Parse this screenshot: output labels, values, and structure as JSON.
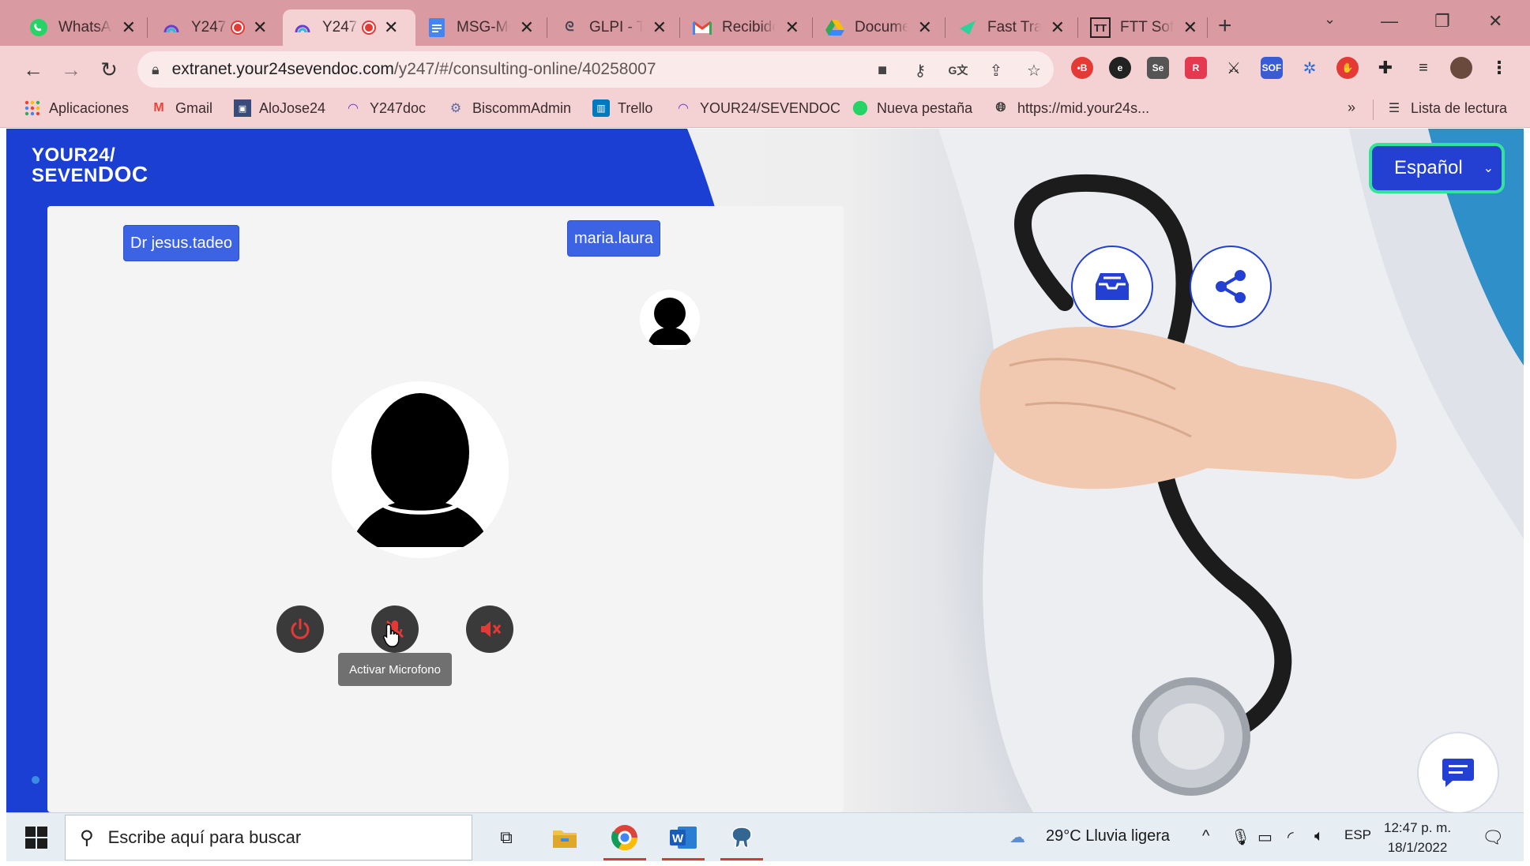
{
  "browser": {
    "tabs": [
      {
        "title": "WhatsApp",
        "icon": "whatsapp-icon",
        "recording": false
      },
      {
        "title": "Y247",
        "icon": "y247-icon",
        "recording": true
      },
      {
        "title": "Y247",
        "icon": "y247-icon",
        "recording": true,
        "active": true
      },
      {
        "title": "MSG-Me",
        "icon": "docs-icon",
        "recording": false
      },
      {
        "title": "GLPI - Ti",
        "icon": "glpi-icon",
        "recording": false
      },
      {
        "title": "Recibido",
        "icon": "gmail-icon",
        "recording": false
      },
      {
        "title": "Documen",
        "icon": "drive-icon",
        "recording": false
      },
      {
        "title": "Fast Trac",
        "icon": "fasttrack-icon",
        "recording": false
      },
      {
        "title": "FTT Softw",
        "icon": "ftt-icon",
        "recording": false
      }
    ],
    "url_host": "extranet.your24sevendoc.com",
    "url_path": "/y247/#/consulting-online/40258007",
    "bookmarks": [
      {
        "label": "Aplicaciones",
        "icon": "apps-grid-icon"
      },
      {
        "label": "Gmail",
        "icon": "gmail-icon"
      },
      {
        "label": "AloJose24",
        "icon": "bookmark-page-icon"
      },
      {
        "label": "Y247doc",
        "icon": "y247-icon"
      },
      {
        "label": "BiscommAdmin",
        "icon": "biscomm-icon"
      },
      {
        "label": "Trello",
        "icon": "trello-icon"
      },
      {
        "label": "YOUR24/SEVENDOC",
        "icon": "y247-icon"
      },
      {
        "label": "Nueva pestaña",
        "icon": "whatsapp-icon"
      },
      {
        "label": "https://mid.your24s...",
        "icon": "globe-icon"
      }
    ],
    "more_bookmarks": "»",
    "reading_list": "Lista de lectura"
  },
  "app": {
    "logo_line1": "YOUR24/",
    "logo_line2": "SEVEN",
    "logo_line2b": "DOC",
    "language": "Español",
    "doctor_tag": "Dr jesus.tadeo",
    "patient_tag": "maria.laura",
    "tooltip": "Activar Microfono",
    "colors": {
      "brand_blue": "#1b3fd3",
      "accent_green": "#32e39a",
      "danger_red": "#e53935"
    }
  },
  "taskbar": {
    "search_placeholder": "Escribe aquí para buscar",
    "weather": "29°C  Lluvia ligera",
    "lang": "ESP",
    "time": "12:47 p. m.",
    "date": "18/1/2022"
  }
}
